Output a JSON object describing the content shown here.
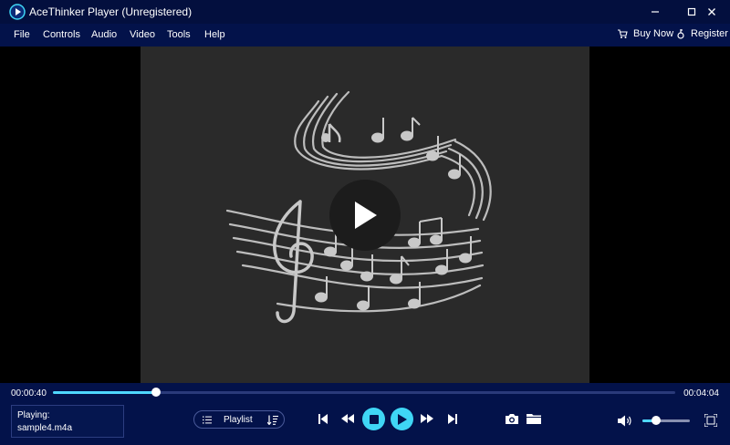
{
  "window": {
    "title": "AceThinker Player (Unregistered)"
  },
  "menu": {
    "items": [
      {
        "label": "File"
      },
      {
        "label": "Controls"
      },
      {
        "label": "Audio"
      },
      {
        "label": "Video"
      },
      {
        "label": "Tools"
      },
      {
        "label": "Help"
      }
    ],
    "buy_now": "Buy Now",
    "register": "Register"
  },
  "player": {
    "current_time": "00:00:40",
    "total_time": "00:04:04",
    "progress_fraction": 0.165,
    "volume_fraction": 0.28,
    "playing_label": "Playing:",
    "playing_file": "sample4.m4a",
    "playlist_label": "Playlist"
  },
  "colors": {
    "background": "#03124a",
    "accent": "#3fd6f5",
    "video_frame": "#2a2a2a"
  },
  "icons": {
    "logo": "app-logo-icon",
    "cart": "cart-icon",
    "key": "key-icon",
    "play_overlay": "play-overlay-icon"
  }
}
